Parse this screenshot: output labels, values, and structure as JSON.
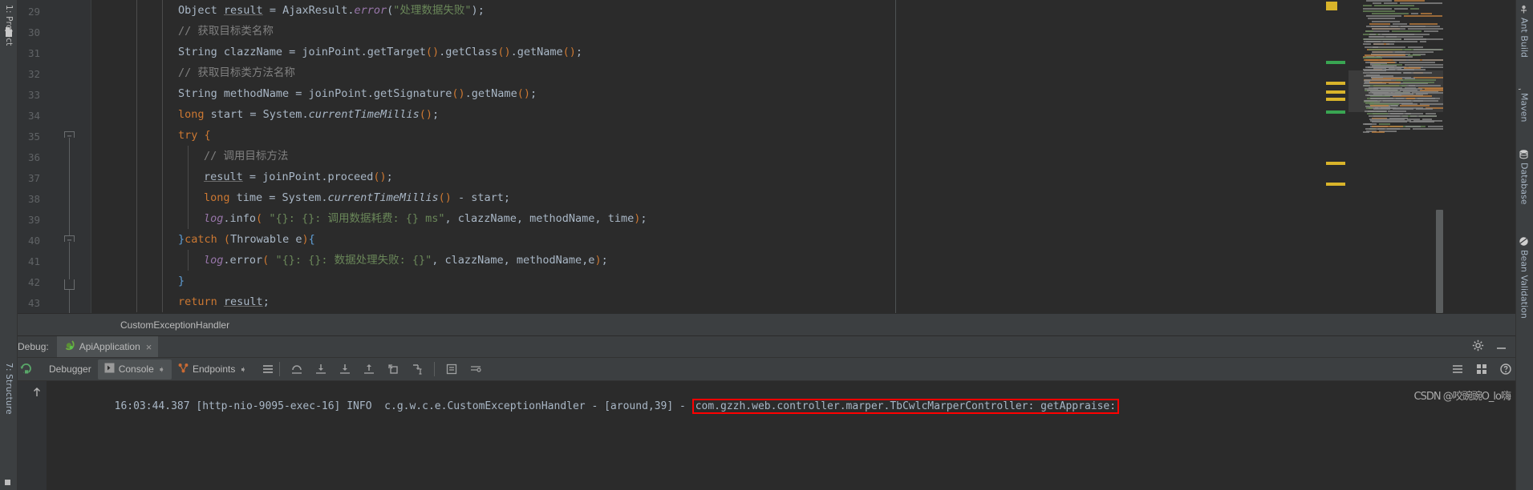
{
  "window": {
    "theme_bg": "#2b2b2b",
    "panel_bg": "#3c3f41",
    "accent_highlight": "#ff0000"
  },
  "left_toolbar": {
    "items": [
      {
        "label": "1: Project",
        "name": "sidebar-item-project"
      },
      {
        "label": "7: Structure",
        "name": "sidebar-item-structure"
      }
    ]
  },
  "right_toolbar": {
    "items": [
      {
        "label": "Ant Build",
        "icon": "ant-build-icon"
      },
      {
        "label": "Maven",
        "icon": "maven-icon"
      },
      {
        "label": "Database",
        "icon": "database-icon"
      },
      {
        "label": "Bean Validation",
        "icon": "bean-validation-icon"
      }
    ]
  },
  "editor": {
    "breadcrumb": "CustomExceptionHandler",
    "first_line": 29,
    "lines": [
      {
        "num": 29,
        "indent": 3,
        "tokens": [
          {
            "t": "Object ",
            "c": "txt"
          },
          {
            "t": "result",
            "c": "var-u"
          },
          {
            "t": " = ",
            "c": "txt"
          },
          {
            "t": "AjaxResult",
            "c": "txt"
          },
          {
            "t": ".",
            "c": "txt"
          },
          {
            "t": "error",
            "c": "fld"
          },
          {
            "t": "(",
            "c": "par"
          },
          {
            "t": "\"处理数据失败\"",
            "c": "str"
          },
          {
            "t": ")",
            "c": "par"
          },
          {
            "t": ";",
            "c": "txt"
          }
        ]
      },
      {
        "num": 30,
        "indent": 3,
        "tokens": [
          {
            "t": "// 获取目标类名称",
            "c": "cmt"
          }
        ]
      },
      {
        "num": 31,
        "indent": 3,
        "tokens": [
          {
            "t": "String clazzName = joinPoint",
            "c": "txt"
          },
          {
            "t": ".",
            "c": "txt"
          },
          {
            "t": "getTarget",
            "c": "txt"
          },
          {
            "t": "()",
            "c": "brace-y"
          },
          {
            "t": ".",
            "c": "txt"
          },
          {
            "t": "getClass",
            "c": "txt"
          },
          {
            "t": "()",
            "c": "brace-y"
          },
          {
            "t": ".",
            "c": "txt"
          },
          {
            "t": "getName",
            "c": "txt"
          },
          {
            "t": "()",
            "c": "brace-y"
          },
          {
            "t": ";",
            "c": "txt"
          }
        ]
      },
      {
        "num": 32,
        "indent": 3,
        "tokens": [
          {
            "t": "// 获取目标类方法名称",
            "c": "cmt"
          }
        ]
      },
      {
        "num": 33,
        "indent": 3,
        "tokens": [
          {
            "t": "String methodName = joinPoint",
            "c": "txt"
          },
          {
            "t": ".",
            "c": "txt"
          },
          {
            "t": "getSignature",
            "c": "txt"
          },
          {
            "t": "()",
            "c": "brace-y"
          },
          {
            "t": ".",
            "c": "txt"
          },
          {
            "t": "getName",
            "c": "txt"
          },
          {
            "t": "()",
            "c": "brace-y"
          },
          {
            "t": ";",
            "c": "txt"
          }
        ]
      },
      {
        "num": 34,
        "indent": 3,
        "tokens": [
          {
            "t": "long",
            "c": "kw"
          },
          {
            "t": " start = System",
            "c": "txt"
          },
          {
            "t": ".",
            "c": "txt"
          },
          {
            "t": "currentTimeMillis",
            "c": "static-i"
          },
          {
            "t": "()",
            "c": "brace-y"
          },
          {
            "t": ";",
            "c": "txt"
          }
        ]
      },
      {
        "num": 35,
        "indent": 3,
        "fold": "pointy",
        "tokens": [
          {
            "t": "try",
            "c": "kw"
          },
          {
            "t": " ",
            "c": "txt"
          },
          {
            "t": "{",
            "c": "brace-y"
          }
        ]
      },
      {
        "num": 36,
        "indent": 4,
        "tokens": [
          {
            "t": "// 调用目标方法",
            "c": "cmt"
          }
        ]
      },
      {
        "num": 37,
        "indent": 4,
        "tokens": [
          {
            "t": "result",
            "c": "var-u"
          },
          {
            "t": " = joinPoint",
            "c": "txt"
          },
          {
            "t": ".",
            "c": "txt"
          },
          {
            "t": "proceed",
            "c": "txt"
          },
          {
            "t": "()",
            "c": "brace-y"
          },
          {
            "t": ";",
            "c": "txt"
          }
        ]
      },
      {
        "num": 38,
        "indent": 4,
        "tokens": [
          {
            "t": "long",
            "c": "kw"
          },
          {
            "t": " time = System",
            "c": "txt"
          },
          {
            "t": ".",
            "c": "txt"
          },
          {
            "t": "currentTimeMillis",
            "c": "static-i"
          },
          {
            "t": "()",
            "c": "brace-y"
          },
          {
            "t": " - start;",
            "c": "txt"
          }
        ]
      },
      {
        "num": 39,
        "indent": 4,
        "tokens": [
          {
            "t": "log",
            "c": "fld"
          },
          {
            "t": ".",
            "c": "txt"
          },
          {
            "t": "info",
            "c": "txt"
          },
          {
            "t": "(",
            "c": "brace-y"
          },
          {
            "t": " \"{}: {}: 调用数据耗费: {} ms\"",
            "c": "str"
          },
          {
            "t": ", clazzName, methodName, time",
            "c": "txt"
          },
          {
            "t": ")",
            "c": "brace-y"
          },
          {
            "t": ";",
            "c": "txt"
          }
        ]
      },
      {
        "num": 40,
        "indent": 3,
        "fold": "pointy",
        "tokens": [
          {
            "t": "}",
            "c": "brace-b"
          },
          {
            "t": "catch",
            "c": "kw"
          },
          {
            "t": " ",
            "c": "txt"
          },
          {
            "t": "(",
            "c": "brace-y"
          },
          {
            "t": "Throwable e",
            "c": "txt"
          },
          {
            "t": ")",
            "c": "brace-y"
          },
          {
            "t": "{",
            "c": "brace-b"
          }
        ]
      },
      {
        "num": 41,
        "indent": 4,
        "tokens": [
          {
            "t": "log",
            "c": "fld"
          },
          {
            "t": ".",
            "c": "txt"
          },
          {
            "t": "error",
            "c": "txt"
          },
          {
            "t": "(",
            "c": "brace-y"
          },
          {
            "t": " \"{}: {}: 数据处理失败: {}\"",
            "c": "str"
          },
          {
            "t": ", clazzName, methodName,e",
            "c": "txt"
          },
          {
            "t": ")",
            "c": "brace-y"
          },
          {
            "t": ";",
            "c": "txt"
          }
        ]
      },
      {
        "num": 42,
        "indent": 3,
        "fold": "house",
        "tokens": [
          {
            "t": "}",
            "c": "brace-b"
          }
        ]
      },
      {
        "num": 43,
        "indent": 3,
        "tokens": [
          {
            "t": "return",
            "c": "kw"
          },
          {
            "t": " ",
            "c": "txt"
          },
          {
            "t": "result",
            "c": "var-u"
          },
          {
            "t": ";",
            "c": "txt"
          }
        ]
      }
    ]
  },
  "debug_panel": {
    "title": "Debug:",
    "run_config": "ApiApplication",
    "close_label": "×",
    "settings_icon": "gear-icon",
    "minimize_icon": "minimize-icon",
    "tabs": [
      {
        "label": "Debugger",
        "icon": "debugger-icon",
        "active": false
      },
      {
        "label": "Console",
        "icon": "console-icon",
        "active": true,
        "pin": "→"
      },
      {
        "label": "Endpoints",
        "icon": "endpoints-icon",
        "active": false,
        "pin": "→"
      }
    ],
    "toolbar_icons": [
      "layout-lines-icon",
      "step-over-icon",
      "step-into-icon",
      "force-step-into-icon",
      "step-out-icon",
      "drop-frame-icon",
      "run-to-cursor-icon",
      "evaluate-icon",
      "watches-icon"
    ],
    "right_icons": [
      "list-icon",
      "settings-icon",
      "help-icon"
    ],
    "rerun_icon": "rerun-icon",
    "resume_icon": "resume-icon",
    "scroll_up_icon": "scroll-up-icon"
  },
  "console": {
    "log_prefix": "16:03:44.387 [http-nio-9095-exec-16] INFO  c.g.w.c.e.CustomExceptionHandler - [around,39] - ",
    "log_highlighted": "com.gzzh.web.controller.marper.TbCwlcMarperController: getAppraise:",
    "watermark": "CSDN @咬豌豌O_lo嗨"
  }
}
